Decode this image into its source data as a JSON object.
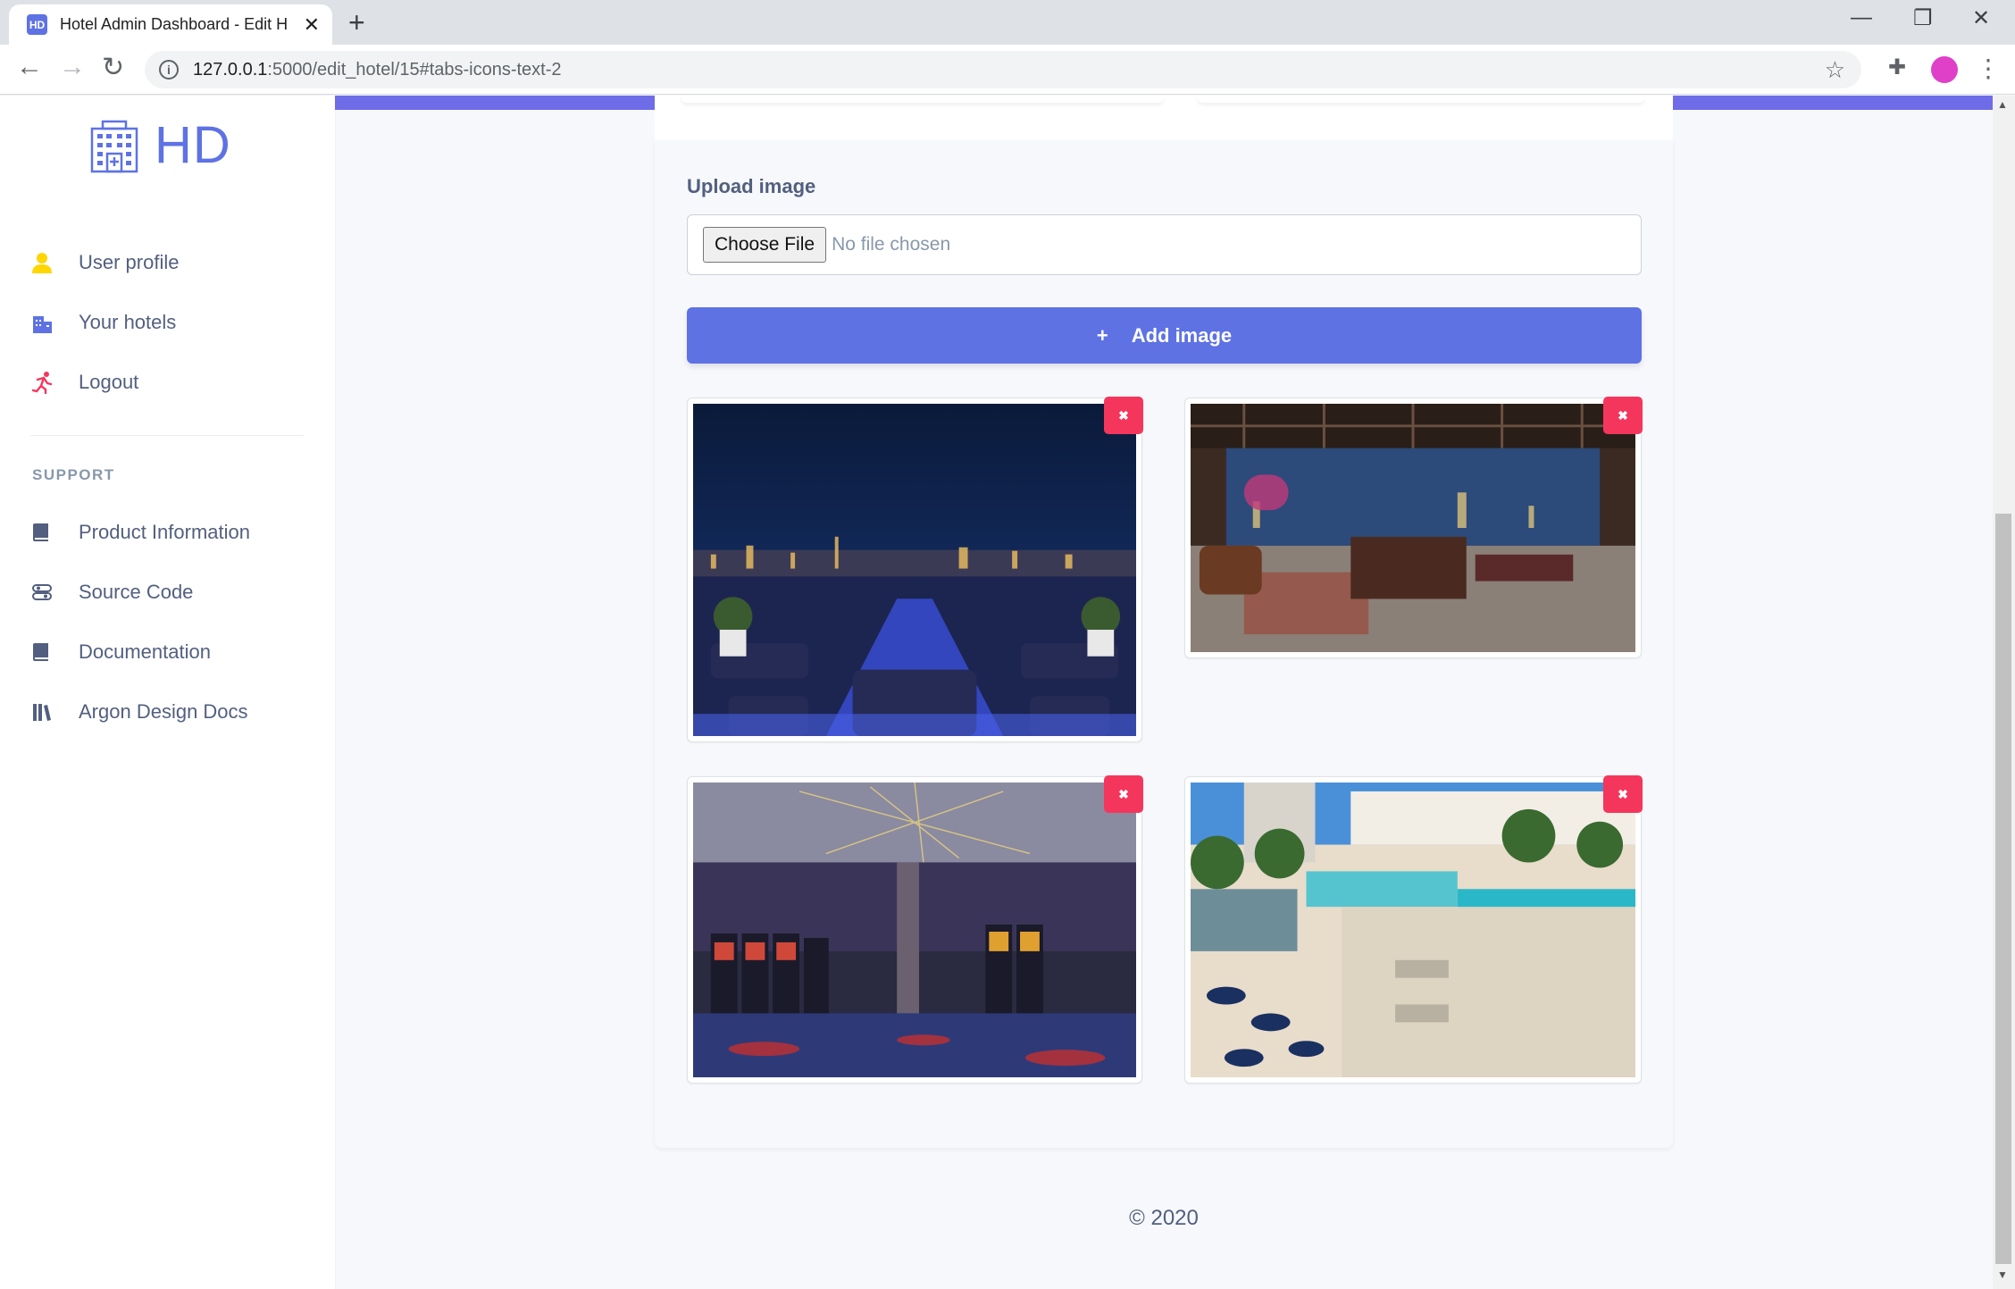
{
  "browser": {
    "tab_title": "Hotel Admin Dashboard - Edit H",
    "favicon_text": "HD",
    "url_host": "127.0.0.1",
    "url_path": ":5000/edit_hotel/15#tabs-icons-text-2"
  },
  "sidebar": {
    "brand": "HD",
    "items": [
      {
        "label": "User profile",
        "icon": "user-icon",
        "color": "#ffd600"
      },
      {
        "label": "Your hotels",
        "icon": "building-icon",
        "color": "#5e72e4"
      },
      {
        "label": "Logout",
        "icon": "running-icon",
        "color": "#f5365c"
      }
    ],
    "support_heading": "SUPPORT",
    "support_items": [
      {
        "label": "Product Information",
        "icon": "book-icon"
      },
      {
        "label": "Source Code",
        "icon": "code-icon"
      },
      {
        "label": "Documentation",
        "icon": "book-icon"
      },
      {
        "label": "Argon Design Docs",
        "icon": "library-icon"
      }
    ]
  },
  "main": {
    "upload_label": "Upload image",
    "choose_file": "Choose File",
    "no_file": "No file chosen",
    "add_image": "Add image",
    "delete_symbol": "✖",
    "footer": "© 2020"
  },
  "colors": {
    "accent": "#5e72e4",
    "danger": "#f5365c",
    "topbar": "#6f6ce8"
  }
}
